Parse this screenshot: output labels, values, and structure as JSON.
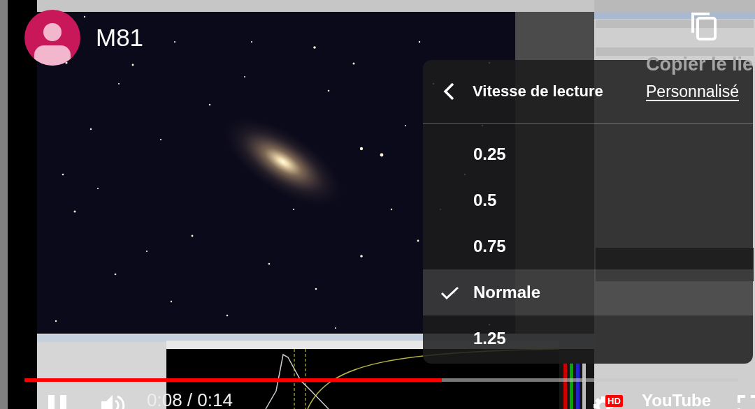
{
  "video": {
    "title": "M81"
  },
  "share": {
    "label": "Copier le lie"
  },
  "settings_menu": {
    "title": "Vitesse de lecture",
    "custom_link": "Personnalisé",
    "options": [
      {
        "label": "0.25",
        "selected": false
      },
      {
        "label": "0.5",
        "selected": false
      },
      {
        "label": "0.75",
        "selected": false
      },
      {
        "label": "Normale",
        "selected": true
      },
      {
        "label": "1.25",
        "selected": false
      }
    ]
  },
  "progress": {
    "level": 0.585
  },
  "controls": {
    "playing": true,
    "muted": false,
    "time": "0:08 / 0:14",
    "quality_badge": "HD",
    "logo": "YouTube"
  }
}
